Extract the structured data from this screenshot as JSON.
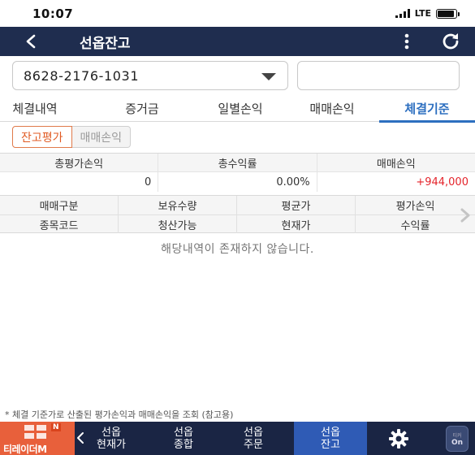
{
  "status_bar": {
    "time": "10:07",
    "network": "LTE",
    "battery_level": 0.9
  },
  "header": {
    "title": "선옵잔고"
  },
  "account": {
    "number": "8628-2176-1031",
    "password_value": ""
  },
  "tabs": [
    {
      "label": "체결내역"
    },
    {
      "label": "증거금"
    },
    {
      "label": "일별손익"
    },
    {
      "label": "매매손익"
    },
    {
      "label": "체결기준",
      "active": true
    }
  ],
  "subtabs": [
    {
      "label": "잔고평가",
      "active": true
    },
    {
      "label": "매매손익",
      "active": false
    }
  ],
  "summary": {
    "headers": [
      "총평가손익",
      "총수익률",
      "매매손익"
    ],
    "values": [
      "0",
      "0.00%",
      "+944,000"
    ],
    "positive_color": "#e4242b"
  },
  "detail_columns": {
    "row1": [
      "매매구분",
      "보유수량",
      "평균가",
      "평가손익"
    ],
    "row2": [
      "종목코드",
      "청산가능",
      "현재가",
      "수익률"
    ]
  },
  "empty_message": "해당내역이 존재하지 않습니다.",
  "footnote": "* 체결 기준가로 산출된 평가손익과 매매손익을 조회 (참고용)",
  "bottom_nav": {
    "brand": "티레이더M",
    "brand_badge": "N",
    "items": [
      {
        "line1": "선옵",
        "line2": "현재가"
      },
      {
        "line1": "선옵",
        "line2": "종합"
      },
      {
        "line1": "선옵",
        "line2": "주문"
      },
      {
        "line1": "선옵",
        "line2": "잔고",
        "active": true
      }
    ],
    "toggle_top": "티커",
    "toggle_bottom": "On"
  },
  "colors": {
    "header_bg": "#1f2d4f",
    "accent_blue": "#2d6fc0",
    "accent_orange": "#e05a22",
    "nav_bg": "#1a2544",
    "nav_active": "#2f5bb5",
    "brand_bg": "#e8603b"
  }
}
